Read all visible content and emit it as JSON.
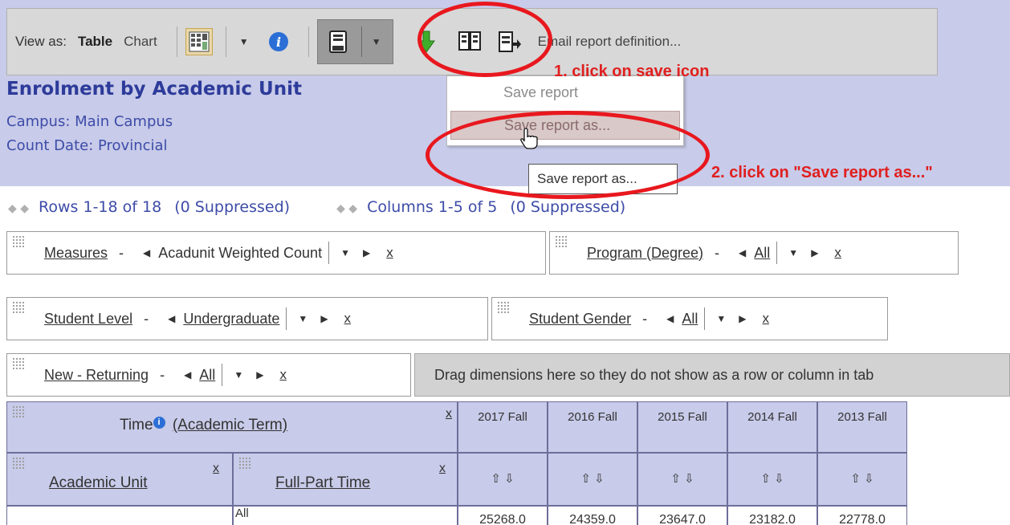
{
  "toolbar": {
    "view_as_label": "View as:",
    "table_label": "Table",
    "chart_label": "Chart",
    "email_label": "Email report definition..."
  },
  "report": {
    "title": "Enrolment by Academic Unit",
    "campus": "Campus: Main Campus",
    "count_date": "Count Date: Provincial"
  },
  "save_menu": {
    "items": [
      "Save report",
      "Save report as..."
    ],
    "tooltip": "Save report as..."
  },
  "annotations": {
    "step1": "1. click on save icon",
    "step2": "2. click on \"Save report as...\""
  },
  "paging": {
    "rows": "Rows 1-18 of 18",
    "rows_suppressed": "(0 Suppressed)",
    "columns": "Columns 1-5 of 5",
    "columns_suppressed": "(0 Suppressed)"
  },
  "dimensions": [
    {
      "name": "Measures",
      "member": "Acadunit Weighted Count",
      "underline_member": false
    },
    {
      "name": "Program (Degree)",
      "member": "All",
      "underline_member": true
    },
    {
      "name": "Student Level",
      "member": "Undergraduate",
      "underline_member": true
    },
    {
      "name": "Student Gender",
      "member": "All",
      "underline_member": true
    },
    {
      "name": "New - Returning",
      "member": "All",
      "underline_member": true
    }
  ],
  "dropzone_text": "Drag dimensions here so they do not show as a row or column in tab",
  "pivot": {
    "time_header": "Time",
    "time_link": "(Academic Term)",
    "row_headers": [
      "Academic Unit",
      "Full-Part Time"
    ],
    "columns": [
      "2017 Fall",
      "2016 Fall",
      "2015 Fall",
      "2014 Fall",
      "2013 Fall"
    ],
    "first_row_label": "All",
    "first_row_values": [
      "25268.0",
      "24359.0",
      "23647.0",
      "23182.0",
      "22778.0"
    ],
    "close": "x",
    "sort": "⇧ ⇩"
  },
  "colors": {
    "header_band": "#c8cbe9",
    "title": "#2d3b9a",
    "annotation": "#e01f1f"
  }
}
